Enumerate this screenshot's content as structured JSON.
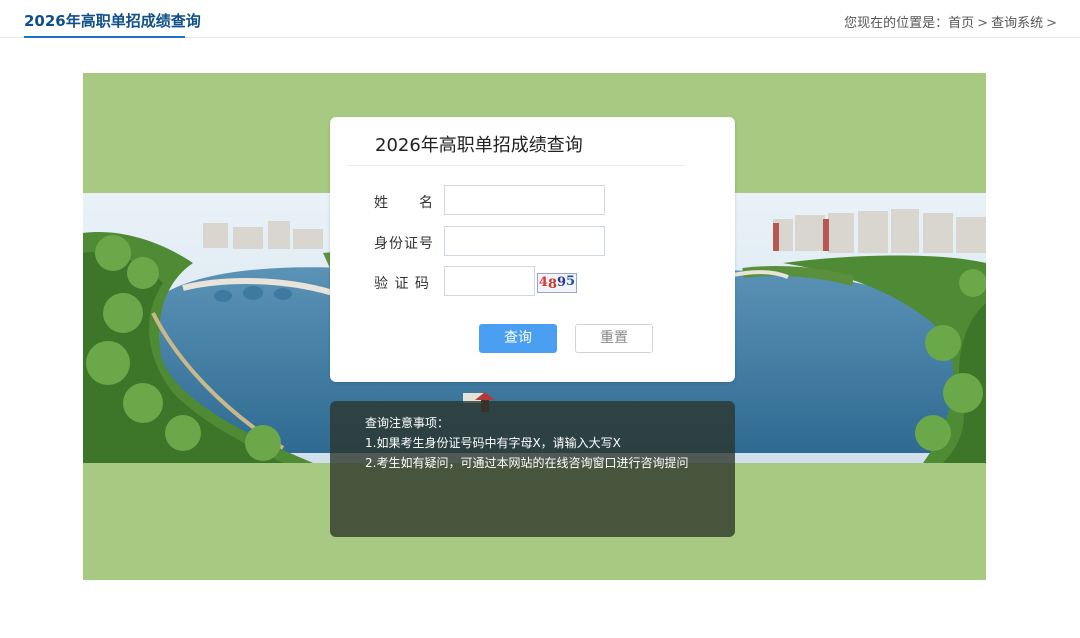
{
  "header": {
    "page_title": "2026年高职单招成绩查询",
    "breadcrumb": {
      "prefix": "您现在的位置是：",
      "items": [
        "首页",
        "查询系统"
      ],
      "separator": ">"
    }
  },
  "form": {
    "title": "2026年高职单招成绩查询",
    "name_label": "姓　　名",
    "id_label": "身份证号",
    "captcha_label": "验 证 码",
    "name_value": "",
    "id_value": "",
    "captcha_value": "",
    "captcha_digits": [
      "4",
      "8",
      "9",
      "5"
    ],
    "query_button": "查询",
    "reset_button": "重置"
  },
  "notice": {
    "title": "查询注意事项：",
    "items": [
      "1.如果考生身份证号码中有字母X，请输入大写X",
      "2.考生如有疑问，可通过本网站的在线咨询窗口进行咨询提问"
    ]
  },
  "colors": {
    "accent": "#1d74c5",
    "title_text": "#0f4f8a",
    "banner_green": "#a7c981",
    "query_button": "#4a9ff2"
  }
}
